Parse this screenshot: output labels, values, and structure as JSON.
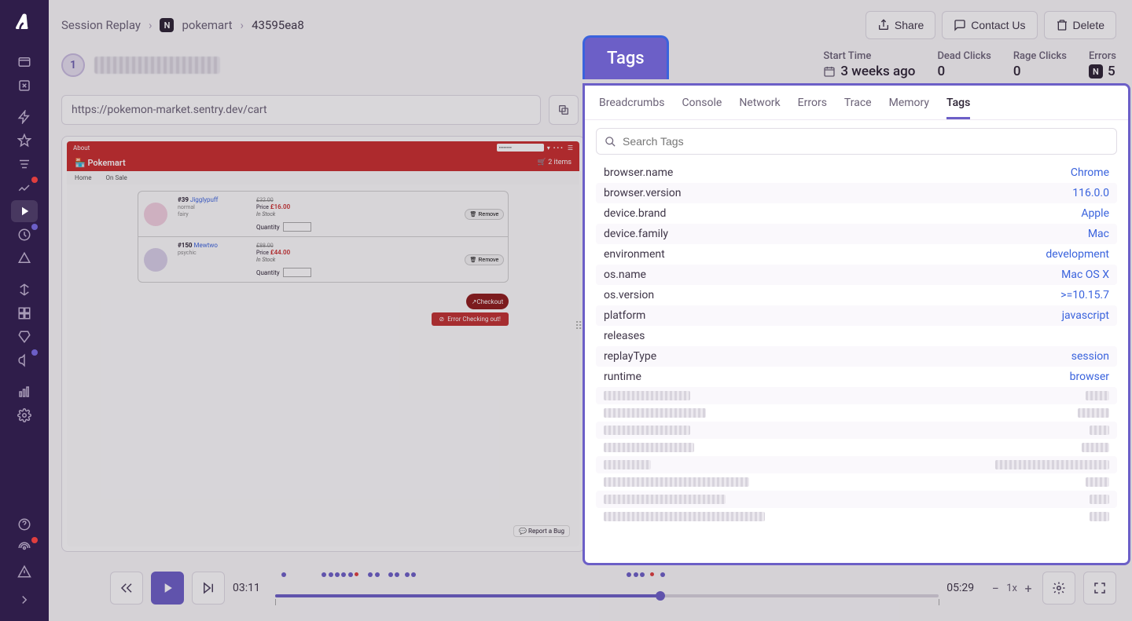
{
  "breadcrumb": {
    "root": "Session Replay",
    "project": "pokemart",
    "id": "43595ea8"
  },
  "actions": {
    "share": "Share",
    "contact": "Contact Us",
    "delete": "Delete"
  },
  "avatar": "1",
  "stats": {
    "startTime": {
      "label": "Start Time",
      "value": "3 weeks ago"
    },
    "deadClicks": {
      "label": "Dead Clicks",
      "value": "0"
    },
    "rageClicks": {
      "label": "Rage Clicks",
      "value": "0"
    },
    "errors": {
      "label": "Errors",
      "value": "5"
    }
  },
  "url": "https://pokemon-market.sentry.dev/cart",
  "replay": {
    "aboutTab": "About",
    "storeName": "Pokemart",
    "cartCount": "2 items",
    "nav": {
      "home": "Home",
      "onsale": "On Sale"
    },
    "items": [
      {
        "num": "#39",
        "name": "Jigglypuff",
        "sub1": "normal",
        "sub2": "fairy",
        "old": "£32.00",
        "new": "£16.00",
        "stock": "In Stock",
        "qty": "Quantity",
        "remove": "Remove"
      },
      {
        "num": "#150",
        "name": "Mewtwo",
        "sub1": "psychic",
        "sub2": "",
        "old": "£88.00",
        "new": "£44.00",
        "stock": "In Stock",
        "qty": "Quantity",
        "remove": "Remove"
      }
    ],
    "checkout": "Checkout",
    "error": "Error Checking out!",
    "reportBug": "Report a Bug",
    "priceLabel": "Price"
  },
  "playback": {
    "current": "03:11",
    "total": "05:29",
    "speed": "1x"
  },
  "panel": {
    "title": "Tags",
    "tabs": [
      "Breadcrumbs",
      "Console",
      "Network",
      "Errors",
      "Trace",
      "Memory",
      "Tags"
    ],
    "searchPlaceholder": "Search Tags",
    "tags": [
      {
        "key": "browser.name",
        "value": "Chrome"
      },
      {
        "key": "browser.version",
        "value": "116.0.0"
      },
      {
        "key": "device.brand",
        "value": "Apple"
      },
      {
        "key": "device.family",
        "value": "Mac"
      },
      {
        "key": "environment",
        "value": "development"
      },
      {
        "key": "os.name",
        "value": "Mac OS X"
      },
      {
        "key": "os.version",
        "value": ">=10.15.7"
      },
      {
        "key": "platform",
        "value": "javascript"
      },
      {
        "key": "releases",
        "value": ""
      },
      {
        "key": "replayType",
        "value": "session"
      },
      {
        "key": "runtime",
        "value": "browser"
      }
    ],
    "blurred": [
      {
        "kw": 110,
        "vw": 30
      },
      {
        "kw": 130,
        "vw": 40
      },
      {
        "kw": 110,
        "vw": 25
      },
      {
        "kw": 115,
        "vw": 35
      },
      {
        "kw": 60,
        "vw": 145
      },
      {
        "kw": 185,
        "vw": 30
      },
      {
        "kw": 155,
        "vw": 25
      },
      {
        "kw": 205,
        "vw": 25
      }
    ]
  }
}
